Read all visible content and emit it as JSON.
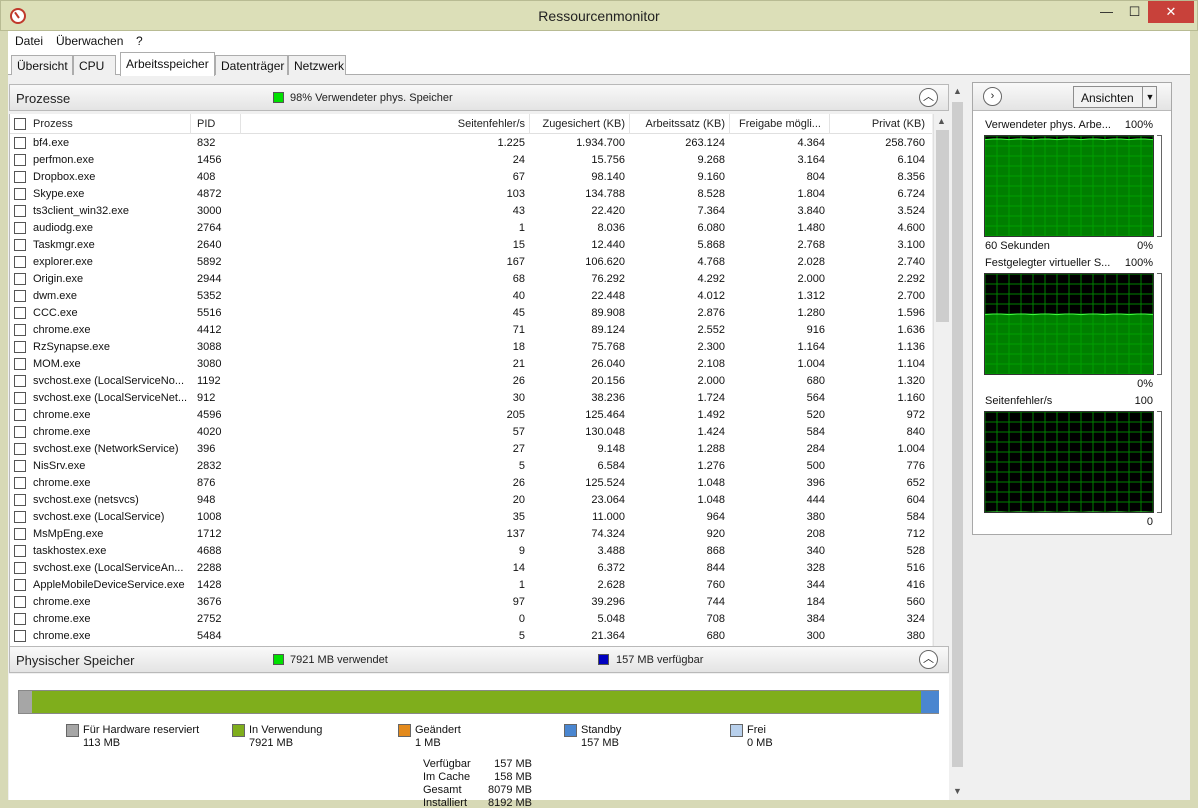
{
  "window": {
    "title": "Ressourcenmonitor",
    "min": "—",
    "max": "☐",
    "close": "✕"
  },
  "menu": [
    "Datei",
    "Überwachen",
    "?"
  ],
  "tabs": [
    "Übersicht",
    "CPU",
    "Arbeitsspeicher",
    "Datenträger",
    "Netzwerk"
  ],
  "active_tab": "Arbeitsspeicher",
  "processes_panel": {
    "title": "Prozesse",
    "legend_color": "#00e000",
    "legend_text": "98% Verwendeter phys. Speicher",
    "collapse_icon": "chevron-up",
    "columns": [
      "Prozess",
      "PID",
      "Seitenfehler/s",
      "Zugesichert (KB)",
      "Arbeitssatz (KB)",
      "Freigabe mögli...",
      "Privat (KB)"
    ],
    "rows": [
      [
        "bf4.exe",
        "832",
        "1.225",
        "1.934.700",
        "263.124",
        "4.364",
        "258.760"
      ],
      [
        "perfmon.exe",
        "1456",
        "24",
        "15.756",
        "9.268",
        "3.164",
        "6.104"
      ],
      [
        "Dropbox.exe",
        "408",
        "67",
        "98.140",
        "9.160",
        "804",
        "8.356"
      ],
      [
        "Skype.exe",
        "4872",
        "103",
        "134.788",
        "8.528",
        "1.804",
        "6.724"
      ],
      [
        "ts3client_win32.exe",
        "3000",
        "43",
        "22.420",
        "7.364",
        "3.840",
        "3.524"
      ],
      [
        "audiodg.exe",
        "2764",
        "1",
        "8.036",
        "6.080",
        "1.480",
        "4.600"
      ],
      [
        "Taskmgr.exe",
        "2640",
        "15",
        "12.440",
        "5.868",
        "2.768",
        "3.100"
      ],
      [
        "explorer.exe",
        "5892",
        "167",
        "106.620",
        "4.768",
        "2.028",
        "2.740"
      ],
      [
        "Origin.exe",
        "2944",
        "68",
        "76.292",
        "4.292",
        "2.000",
        "2.292"
      ],
      [
        "dwm.exe",
        "5352",
        "40",
        "22.448",
        "4.012",
        "1.312",
        "2.700"
      ],
      [
        "CCC.exe",
        "5516",
        "45",
        "89.908",
        "2.876",
        "1.280",
        "1.596"
      ],
      [
        "chrome.exe",
        "4412",
        "71",
        "89.124",
        "2.552",
        "916",
        "1.636"
      ],
      [
        "RzSynapse.exe",
        "3088",
        "18",
        "75.768",
        "2.300",
        "1.164",
        "1.136"
      ],
      [
        "MOM.exe",
        "3080",
        "21",
        "26.040",
        "2.108",
        "1.004",
        "1.104"
      ],
      [
        "svchost.exe (LocalServiceNo...",
        "1192",
        "26",
        "20.156",
        "2.000",
        "680",
        "1.320"
      ],
      [
        "svchost.exe (LocalServiceNet...",
        "912",
        "30",
        "38.236",
        "1.724",
        "564",
        "1.160"
      ],
      [
        "chrome.exe",
        "4596",
        "205",
        "125.464",
        "1.492",
        "520",
        "972"
      ],
      [
        "chrome.exe",
        "4020",
        "57",
        "130.048",
        "1.424",
        "584",
        "840"
      ],
      [
        "svchost.exe (NetworkService)",
        "396",
        "27",
        "9.148",
        "1.288",
        "284",
        "1.004"
      ],
      [
        "NisSrv.exe",
        "2832",
        "5",
        "6.584",
        "1.276",
        "500",
        "776"
      ],
      [
        "chrome.exe",
        "876",
        "26",
        "125.524",
        "1.048",
        "396",
        "652"
      ],
      [
        "svchost.exe (netsvcs)",
        "948",
        "20",
        "23.064",
        "1.048",
        "444",
        "604"
      ],
      [
        "svchost.exe (LocalService)",
        "1008",
        "35",
        "11.000",
        "964",
        "380",
        "584"
      ],
      [
        "MsMpEng.exe",
        "1712",
        "137",
        "74.324",
        "920",
        "208",
        "712"
      ],
      [
        "taskhostex.exe",
        "4688",
        "9",
        "3.488",
        "868",
        "340",
        "528"
      ],
      [
        "svchost.exe (LocalServiceAn...",
        "2288",
        "14",
        "6.372",
        "844",
        "328",
        "516"
      ],
      [
        "AppleMobileDeviceService.exe",
        "1428",
        "1",
        "2.628",
        "760",
        "344",
        "416"
      ],
      [
        "chrome.exe",
        "3676",
        "97",
        "39.296",
        "744",
        "184",
        "560"
      ],
      [
        "chrome.exe",
        "2752",
        "0",
        "5.048",
        "708",
        "384",
        "324"
      ],
      [
        "chrome.exe",
        "5484",
        "5",
        "21.364",
        "680",
        "300",
        "380"
      ]
    ]
  },
  "memory_panel": {
    "title": "Physischer Speicher",
    "used_color": "#00e000",
    "used_text": "7921 MB verwendet",
    "avail_color": "#0000c0",
    "avail_text": "157 MB verfügbar",
    "collapse_icon": "chevron-up",
    "bar_colors": {
      "reserved": "#a6a6a6",
      "in_use": "#7fae1c",
      "modified": "#e38a1c",
      "standby": "#4a86d0",
      "free": "#b8d0ec"
    },
    "bar_mb": {
      "reserved": 113,
      "in_use": 7921,
      "modified": 1,
      "standby": 157,
      "free": 0
    },
    "legend": [
      {
        "label": "Für Hardware reserviert",
        "value": "113 MB"
      },
      {
        "label": "In Verwendung",
        "value": "7921 MB"
      },
      {
        "label": "Geändert",
        "value": "1 MB"
      },
      {
        "label": "Standby",
        "value": "157 MB"
      },
      {
        "label": "Frei",
        "value": "0 MB"
      }
    ],
    "summary": [
      {
        "label": "Verfügbar",
        "value": "157 MB"
      },
      {
        "label": "Im Cache",
        "value": "158 MB"
      },
      {
        "label": "Gesamt",
        "value": "8079 MB"
      },
      {
        "label": "Installiert",
        "value": "8192 MB"
      }
    ]
  },
  "right_pane": {
    "view_button": "Ansichten",
    "expand_icon": "chevron-right",
    "graphs": [
      {
        "title": "Verwendeter phys. Arbe...",
        "max": "100%",
        "min": "0%",
        "footer": "60 Sekunden",
        "level": 0.97
      },
      {
        "title": "Festgelegter virtueller S...",
        "max": "100%",
        "min": "0%",
        "footer": "",
        "level": 0.6
      },
      {
        "title": "Seitenfehler/s",
        "max": "100",
        "min": "0",
        "footer": "",
        "level": 0.0
      }
    ]
  }
}
